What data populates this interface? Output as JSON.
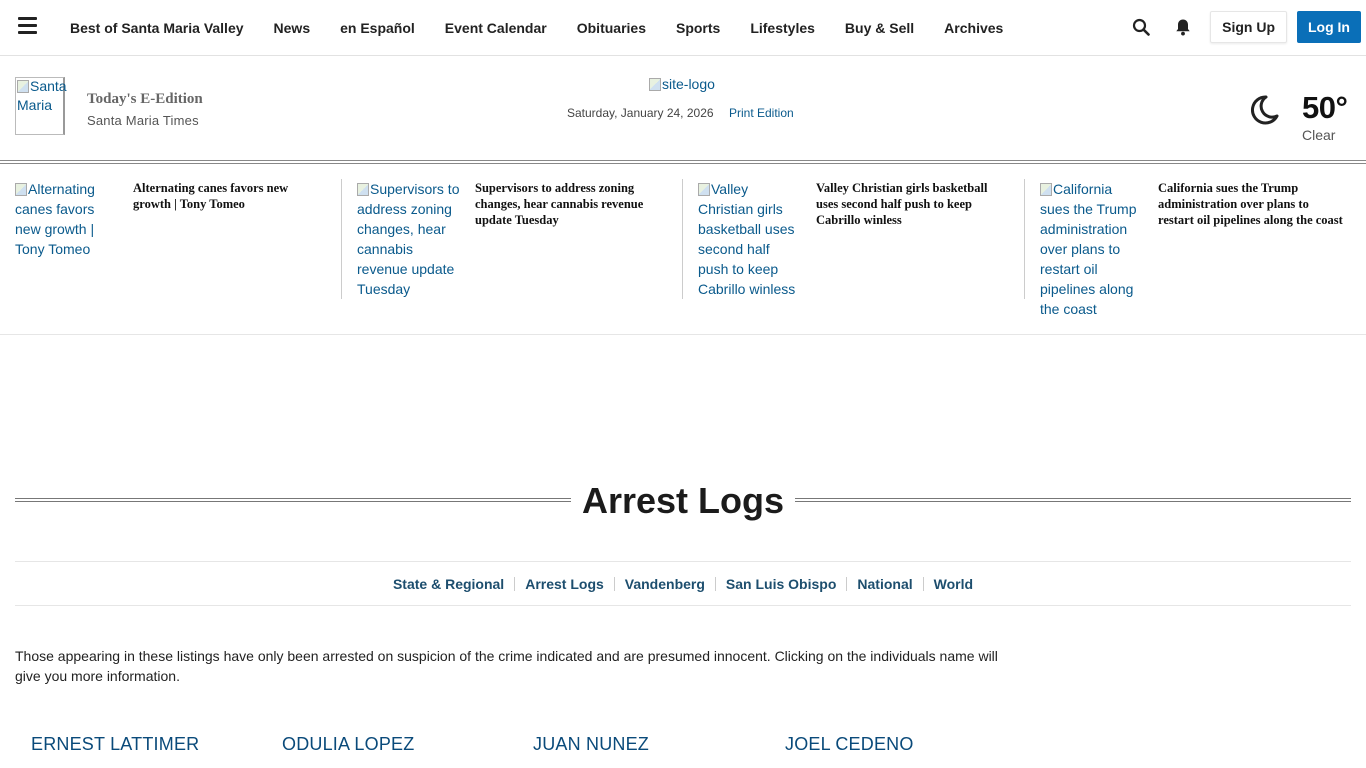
{
  "nav": {
    "links": [
      "Best of Santa Maria Valley",
      "News",
      "en Español",
      "Event Calendar",
      "Obituaries",
      "Sports",
      "Lifestyles",
      "Buy & Sell",
      "Archives"
    ],
    "signup_label": "Sign Up",
    "login_label": "Log In",
    "icons": [
      "menu-icon",
      "search-icon",
      "bell-icon"
    ],
    "accent_color": "#0a6fb8"
  },
  "masthead": {
    "edition_thumb_alt": "Santa Maria",
    "edition_title": "Today's E-Edition",
    "edition_subtitle": "Santa Maria Times",
    "logo_alt": "site-logo",
    "date": "Saturday, January 24, 2026",
    "print_edition": "Print Edition",
    "weather": {
      "temp": "50°",
      "condition": "Clear",
      "icon": "moon-icon"
    }
  },
  "headlines": [
    {
      "thumb_alt": "Alternating canes favors new growth | Tony Tomeo",
      "title": "Alternating canes favors new growth | Tony Tomeo"
    },
    {
      "thumb_alt": "Supervisors to address zoning changes, hear cannabis revenue update Tuesday",
      "title": "Supervisors to address zoning changes, hear cannabis revenue update Tuesday"
    },
    {
      "thumb_alt": "Valley Christian girls basketball uses second half push to keep Cabrillo winless",
      "title": "Valley Christian girls basketball uses second half push to keep Cabrillo winless"
    },
    {
      "thumb_alt": "California sues the Trump administration over plans to restart oil pipelines along the coast",
      "title": "California sues the Trump administration over plans to restart oil pipelines along the coast"
    }
  ],
  "section": {
    "title": "Arrest Logs",
    "subnav": [
      "State & Regional",
      "Arrest Logs",
      "Vandenberg",
      "San Luis Obispo",
      "National",
      "World"
    ],
    "disclaimer": "Those appearing in these listings have only been arrested on suspicion of the crime indicated and are presumed innocent. Clicking on the individuals name will give you more information.",
    "names": [
      "ERNEST LATTIMER",
      "ODULIA LOPEZ",
      "JUAN NUNEZ",
      "JOEL CEDENO"
    ]
  }
}
